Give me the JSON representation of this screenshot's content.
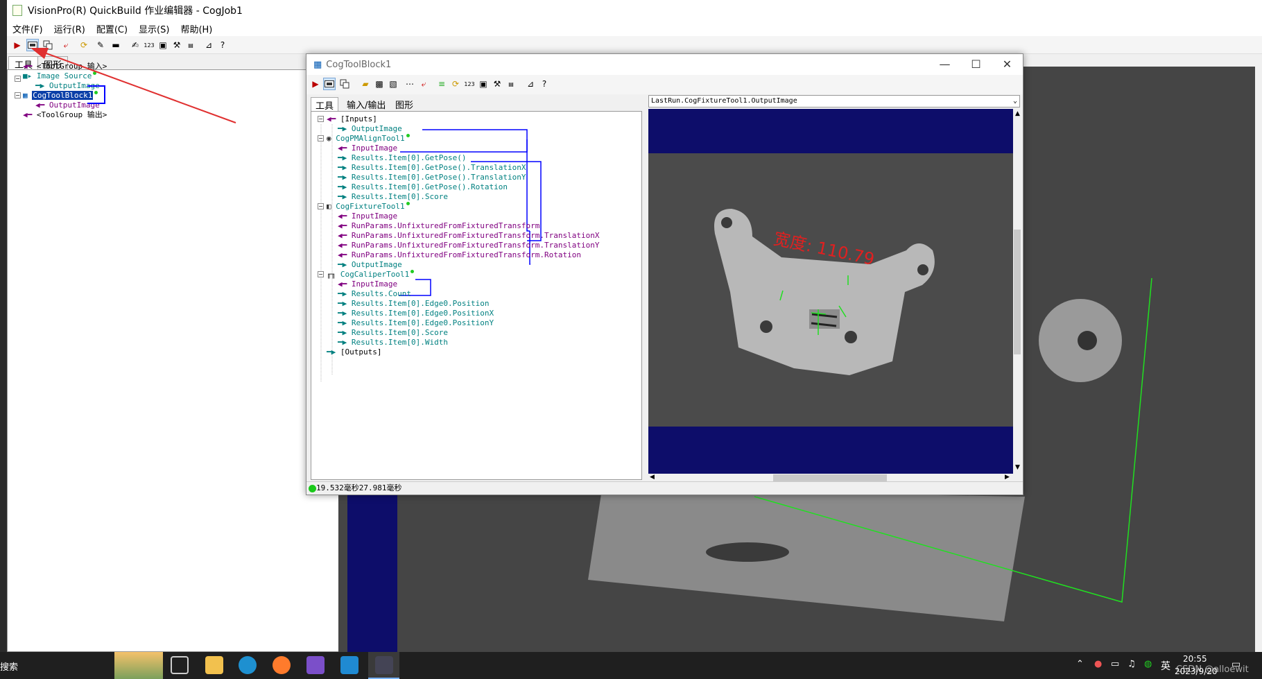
{
  "main_window": {
    "title": "VisionPro(R) QuickBuild 作业编辑器 - CogJob1",
    "menu": [
      "文件(F)",
      "运行(R)",
      "配置(C)",
      "显示(S)",
      "帮助(H)"
    ],
    "tabs": [
      "工具",
      "图形"
    ]
  },
  "left_tree": {
    "input_group": "<ToolGroup 输入>",
    "image_source": "Image Source",
    "image_source_output": "OutputImage",
    "toolblock": "CogToolBlock1",
    "toolblock_output": "OutputImage",
    "output_group": "<ToolGroup 输出>"
  },
  "cog_window": {
    "title": "CogToolBlock1",
    "tabs": [
      "工具",
      "输入/输出",
      "图形"
    ],
    "tree": {
      "inputs": "[Inputs]",
      "inputs_output": "OutputImage",
      "pmalign": "CogPMAlignTool1",
      "pmalign_items": [
        "InputImage",
        "Results.Item[0].GetPose()",
        "Results.Item[0].GetPose().TranslationX",
        "Results.Item[0].GetPose().TranslationY",
        "Results.Item[0].GetPose().Rotation",
        "Results.Item[0].Score"
      ],
      "fixture": "CogFixtureTool1",
      "fixture_items": [
        "InputImage",
        "RunParams.UnfixturedFromFixturedTransform",
        "RunParams.UnfixturedFromFixturedTransform.TranslationX",
        "RunParams.UnfixturedFromFixturedTransform.TranslationY",
        "RunParams.UnfixturedFromFixturedTransform.Rotation",
        "OutputImage"
      ],
      "caliper": "CogCaliperTool1",
      "caliper_items": [
        "InputImage",
        "Results.Count",
        "Results.Item[0].Edge0.Position",
        "Results.Item[0].Edge0.PositionX",
        "Results.Item[0].Edge0.PositionY",
        "Results.Item[0].Score",
        "Results.Item[0].Width"
      ],
      "outputs": "[Outputs]"
    },
    "image_selector": "LastRun.CogFixtureTool1.OutputImage",
    "annotation": "宽度: 110.79",
    "status": "19.532毫秒27.981毫秒"
  },
  "taskbar": {
    "search": "搜索",
    "ime": "英",
    "time": "20:55",
    "date": "2023/9/20",
    "watermark": "CSDN @alloewit"
  },
  "colors": {
    "navy": "#0d0d6a",
    "tree_teal": "#008080",
    "tree_purple": "#800080",
    "link_blue": "#0000ff",
    "annotation_red": "#e02020",
    "graphic_green": "#20e020"
  }
}
